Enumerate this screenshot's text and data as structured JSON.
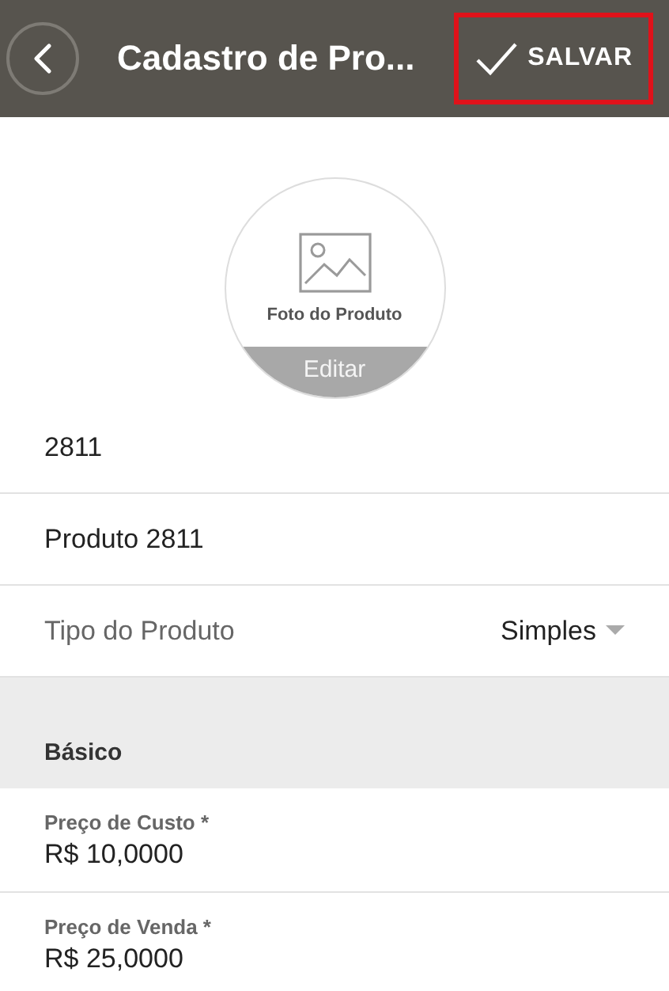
{
  "header": {
    "title": "Cadastro de Pro...",
    "save_button": {
      "label": "SALVAR",
      "highlighted": true
    }
  },
  "photo": {
    "caption": "Foto do Produto",
    "edit_label": "Editar"
  },
  "fields": [
    {
      "kind": "text",
      "value": "2811"
    },
    {
      "kind": "text",
      "value": "Produto 2811"
    },
    {
      "kind": "select",
      "label": "Tipo do Produto",
      "value": "Simples"
    }
  ],
  "section": {
    "title": "Básico"
  },
  "price_fields": [
    {
      "label": "Preço de Custo *",
      "value": "R$ 10,0000"
    },
    {
      "label": "Preço de Venda *",
      "value": "R$ 25,0000"
    }
  ]
}
